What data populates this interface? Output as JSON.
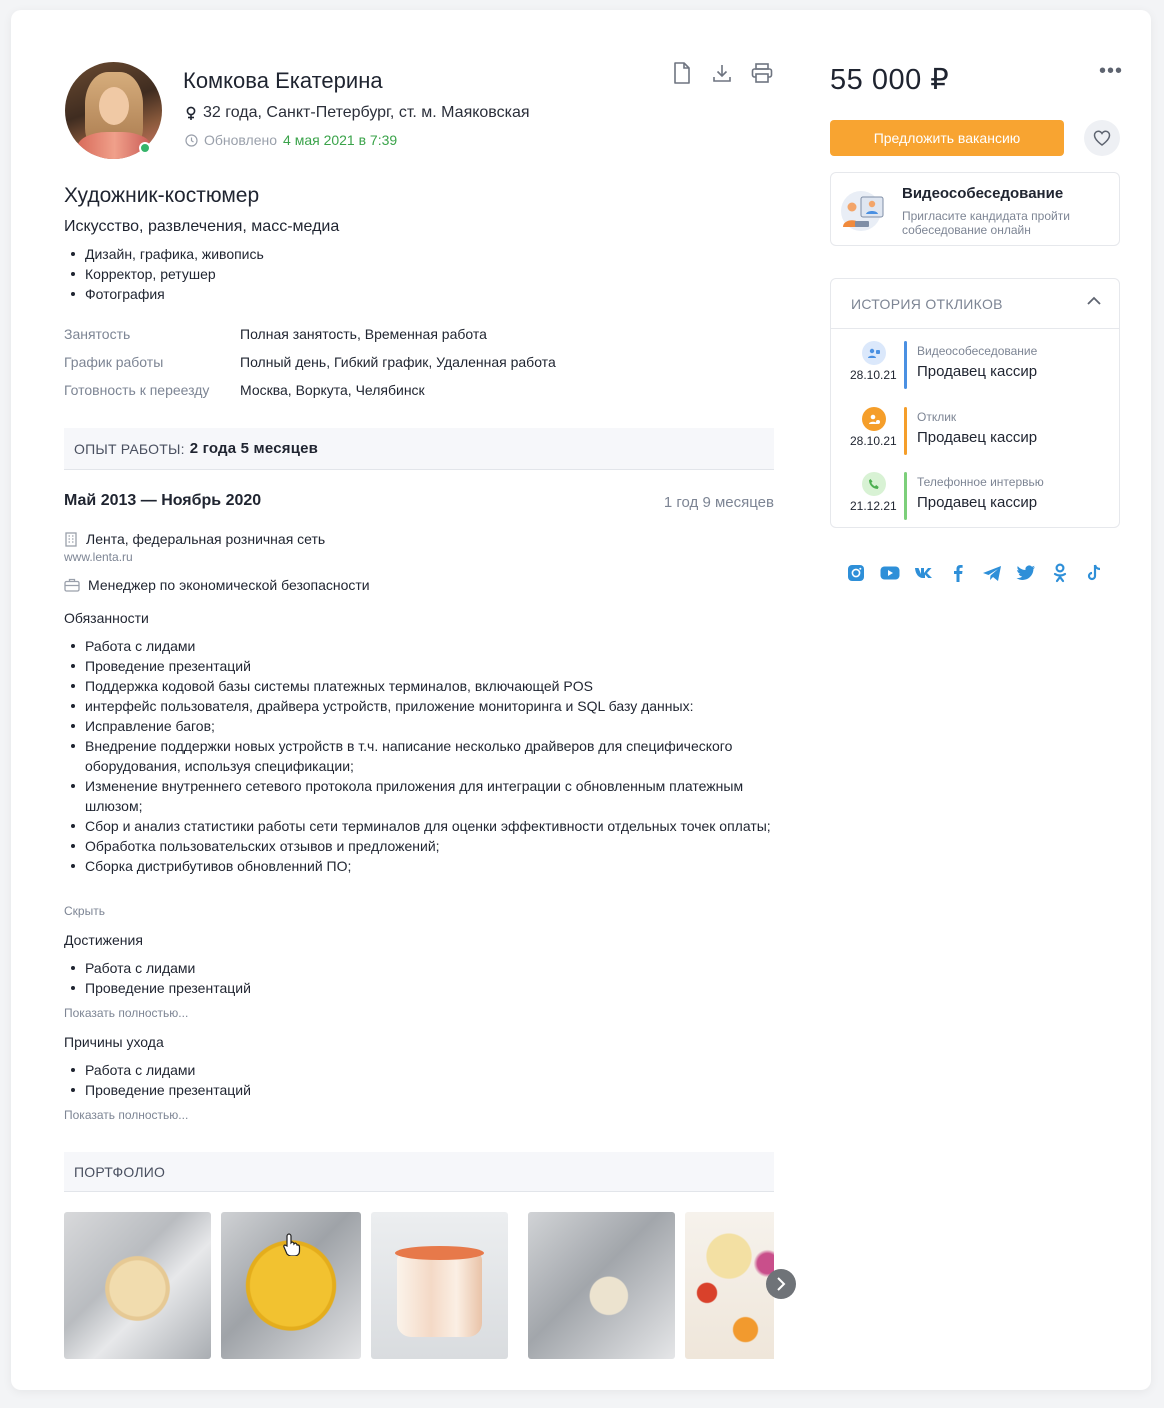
{
  "profile": {
    "name": "Комкова Екатерина",
    "meta": "32 года, Санкт-Петербург, ст. м. Маяковская",
    "updated_prefix": "Обновлено",
    "updated_date": "4 мая 2021 в 7:39",
    "online": true
  },
  "resume": {
    "position": "Художник-костюмер",
    "industry": "Искусство, развлечения, масс-медиа",
    "specializations": [
      "Дизайн, графика, живопись",
      "Корректор, ретушер",
      "Фотография"
    ],
    "params": [
      {
        "label": "Занятость",
        "value": "Полная занятость, Временная работа"
      },
      {
        "label": "График работы",
        "value": "Полный день, Гибкий график, Удаленная работа"
      },
      {
        "label": "Готовность к переезду",
        "value": "Москва, Воркута, Челябинск"
      }
    ]
  },
  "experience": {
    "section_label": "ОПЫТ РАБОТЫ:",
    "total": "2 года 5 месяцев",
    "period": "Май 2013 — Ноябрь 2020",
    "duration": "1 год 9 месяцев",
    "company": "Лента, федеральная розничная сеть",
    "site": "www.lenta.ru",
    "role": "Менеджер по экономической безопасности",
    "duties_title": "Обязанности",
    "duties": [
      "Работа с лидами",
      "Проведение презентаций",
      "Поддержка кодовой базы системы платежных терминалов, включающей POS",
      "интерфейс пользователя, драйвера устройств, приложение мониторинга и SQL базу данных:",
      "Исправление багов;",
      "Внедрение поддержки новых устройств в т.ч. написание несколько драйверов для специфического оборудования, используя спецификации;",
      "Изменение внутреннего сетевого протокола приложения для интеграции с обновленным платежным шлюзом;",
      "Сбор и анализ статистики работы сети терминалов для оценки эффективности отдельных точек оплаты;",
      "Обработка пользовательских отзывов и предложений;",
      "Сборка дистрибутивов обновленний ПО;"
    ],
    "hide_label": "Скрыть",
    "achievements_title": "Достижения",
    "achievements": [
      "Работа с лидами",
      "Проведение презентаций"
    ],
    "show_more_label": "Показать полностью...",
    "reasons_title": "Причины ухода",
    "reasons": [
      "Работа с лидами",
      "Проведение презентаций"
    ]
  },
  "portfolio": {
    "section_label": "ПОРТФОЛИО",
    "items": [
      "ice-cream-vanilla",
      "ice-cream-mango",
      "ice-cream-cup",
      "ice-cream-cookies",
      "cake"
    ]
  },
  "sidebar": {
    "salary": "55 000 ₽",
    "offer_button": "Предложить вакансию",
    "video": {
      "title": "Видеособеседование",
      "subtitle": "Пригласите кандидата пройти собеседование онлайн"
    },
    "history": {
      "title": "ИСТОРИЯ ОТКЛИКОВ",
      "items": [
        {
          "type": "Видеособеседование",
          "vacancy": "Продавец кассир",
          "date": "28.10.21",
          "color": "#4a90e2"
        },
        {
          "type": "Отклик",
          "vacancy": "Продавец кассир",
          "date": "28.10.21",
          "color": "#f59e2a"
        },
        {
          "type": "Телефонное интервью",
          "vacancy": "Продавец кассир",
          "date": "21.12.21",
          "color": "#7ccf7a"
        }
      ]
    },
    "socials": [
      "instagram-icon",
      "youtube-icon",
      "vk-icon",
      "facebook-icon",
      "telegram-icon",
      "twitter-icon",
      "odnoklassniki-icon",
      "tiktok-icon"
    ]
  },
  "colors": {
    "accent": "#f8a431",
    "link_green": "#3aa34a",
    "social_blue": "#2e8fd8"
  }
}
